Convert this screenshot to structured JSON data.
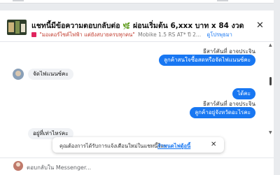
{
  "header": {
    "title": "แชทนี้มีข้อความตอบกลับต่อ",
    "title_suffix": "ผ่อนเริ่มต้น 6,xxx บาท x 84 งวด",
    "title_leaf": "🌿",
    "sub_text": "\"มอเตอร์ไซค์ไฟฟ้า แต่ยังสบายครบทุกคน\"",
    "sub_model": "Mobike 1.5 RS AT* ปี 2...",
    "sub_link": "ดูโปรพุธมา",
    "close": "✕"
  },
  "messages": [
    {
      "name": "ธีสาร์คันที่ อาจประจิน",
      "text": "ลูกค้าสนใจซื้อสดหรือจัดไฟแนนซ์คะ",
      "dir": "out"
    },
    {
      "text": "จัดไฟแนนซ์คะ",
      "dir": "in"
    },
    {
      "text": "ได้คะ",
      "dir": "out"
    },
    {
      "name": "ธีสาร์คันที่ อาจประจิน",
      "text": "ลูกค้าอยู่จังหวัดอะไรคะ",
      "dir": "out"
    },
    {
      "text": "อยู่ที่เท่าไหร่คะ",
      "dir": "in"
    }
  ],
  "toast": {
    "message": "คุณต้องการได้รับการแจ้งเตือนใหม่ในแชทนี้ไหม",
    "action": "กำหนดไฟดู้อนี้",
    "close": "✕"
  },
  "composer": {
    "placeholder": "ตอบกลับใน Messenger..."
  },
  "scroll": {
    "up": "▲",
    "down": "▼"
  },
  "colors": {
    "accent": "#1877f2",
    "incoming": "#f0f2f5"
  }
}
